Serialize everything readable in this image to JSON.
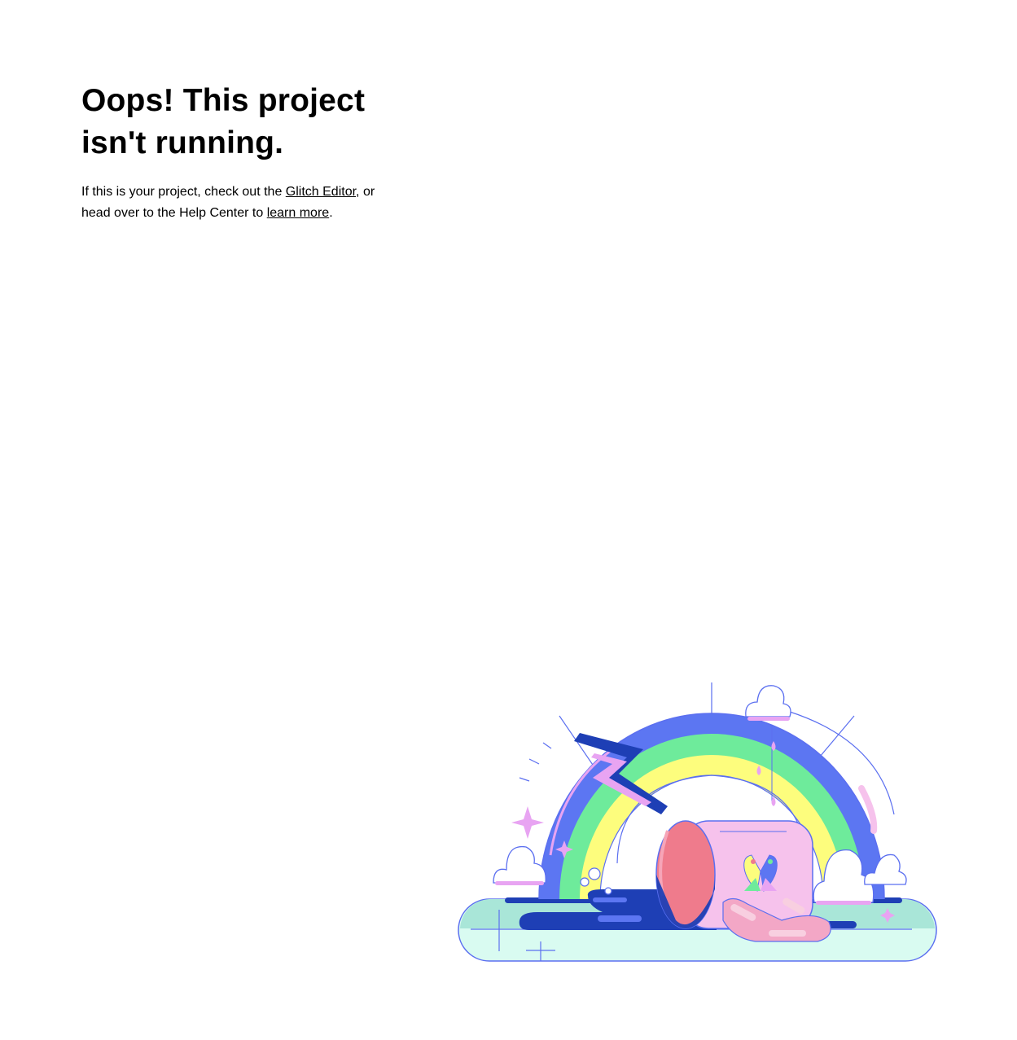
{
  "heading": {
    "line1": "Oops! This project",
    "line2": "isn't running."
  },
  "message": {
    "part1": "If this is your project, check out the ",
    "editor_link": "Glitch Editor",
    "part2": ", or",
    "part3": "head over to the Help Center to ",
    "learn_link": "learn more",
    "part4": "."
  },
  "illustration": {
    "icon": "rainbow-illustration",
    "colors": {
      "outline": "#5b6ff0",
      "band_blue": "#5c76f2",
      "band_green": "#6eeb9b",
      "band_yellow": "#fdfd7d",
      "pink": "#f6c2ec",
      "coral": "#ef7b8c",
      "navy": "#1e3fb5",
      "mint": "#a9e6d8",
      "lilac": "#e8a4f2"
    }
  }
}
